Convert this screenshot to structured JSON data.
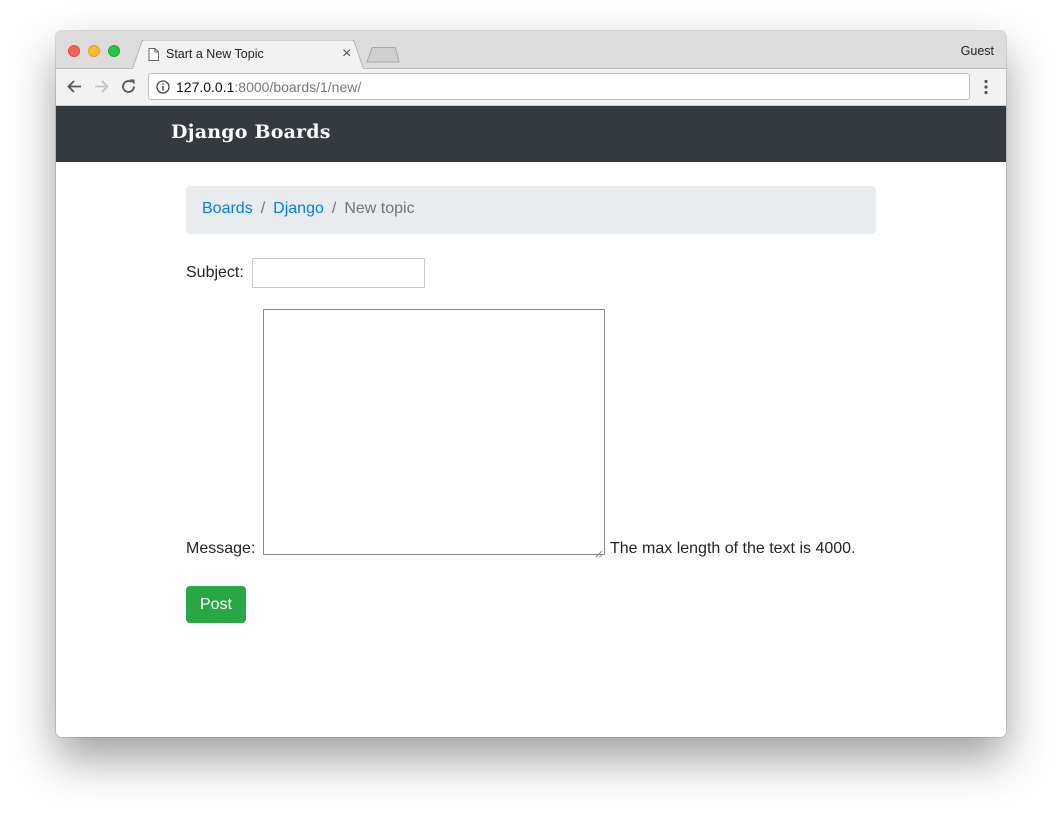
{
  "browser": {
    "tab_title": "Start a New Topic",
    "tab_close": "×",
    "profile_label": "Guest",
    "url_host": "127.0.0.1",
    "url_path": ":8000/boards/1/new/"
  },
  "navbar": {
    "brand": "Django Boards"
  },
  "breadcrumb": {
    "items": [
      "Boards",
      "Django"
    ],
    "separator": "/",
    "active": "New topic"
  },
  "form": {
    "subject_label": "Subject:",
    "subject_value": "",
    "message_label": "Message:",
    "message_value": "",
    "help_text": "The max length of the text is 4000.",
    "submit_label": "Post"
  },
  "colors": {
    "navbar_bg": "#343a40",
    "link": "#007bff",
    "submit_bg": "#28a745",
    "breadcrumb_bg": "#e9ecef"
  }
}
